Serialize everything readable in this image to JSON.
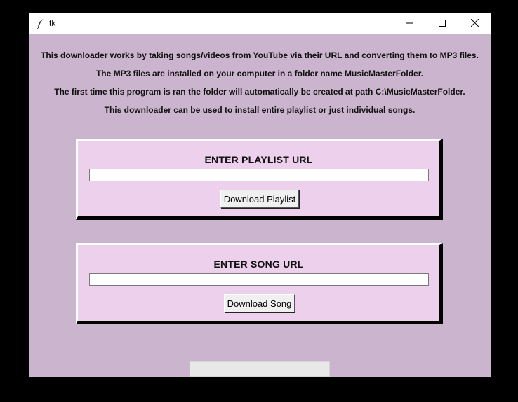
{
  "window": {
    "title": "tk",
    "icon": "feather-icon",
    "controls": {
      "minimize": "minimize-icon",
      "maximize": "maximize-icon",
      "close": "close-icon"
    }
  },
  "info_lines": [
    "This downloader works by taking songs/videos from YouTube via their URL and converting them to MP3 files.",
    "The MP3 files are installed on your computer in a folder name MusicMasterFolder.",
    "The first time this program is ran the folder will automatically be created at path C:\\MusicMasterFolder.",
    "This downloader can be used to install entire playlist or just individual songs."
  ],
  "playlist": {
    "label": "ENTER PLAYLIST URL",
    "value": "",
    "button": "Download Playlist"
  },
  "song": {
    "label": "ENTER SONG URL",
    "value": "",
    "button": "Download Song"
  },
  "status": {
    "text": ""
  },
  "colors": {
    "background": "#cbb4cd",
    "frame": "#ecd0ec",
    "button": "#f0f0f0"
  }
}
